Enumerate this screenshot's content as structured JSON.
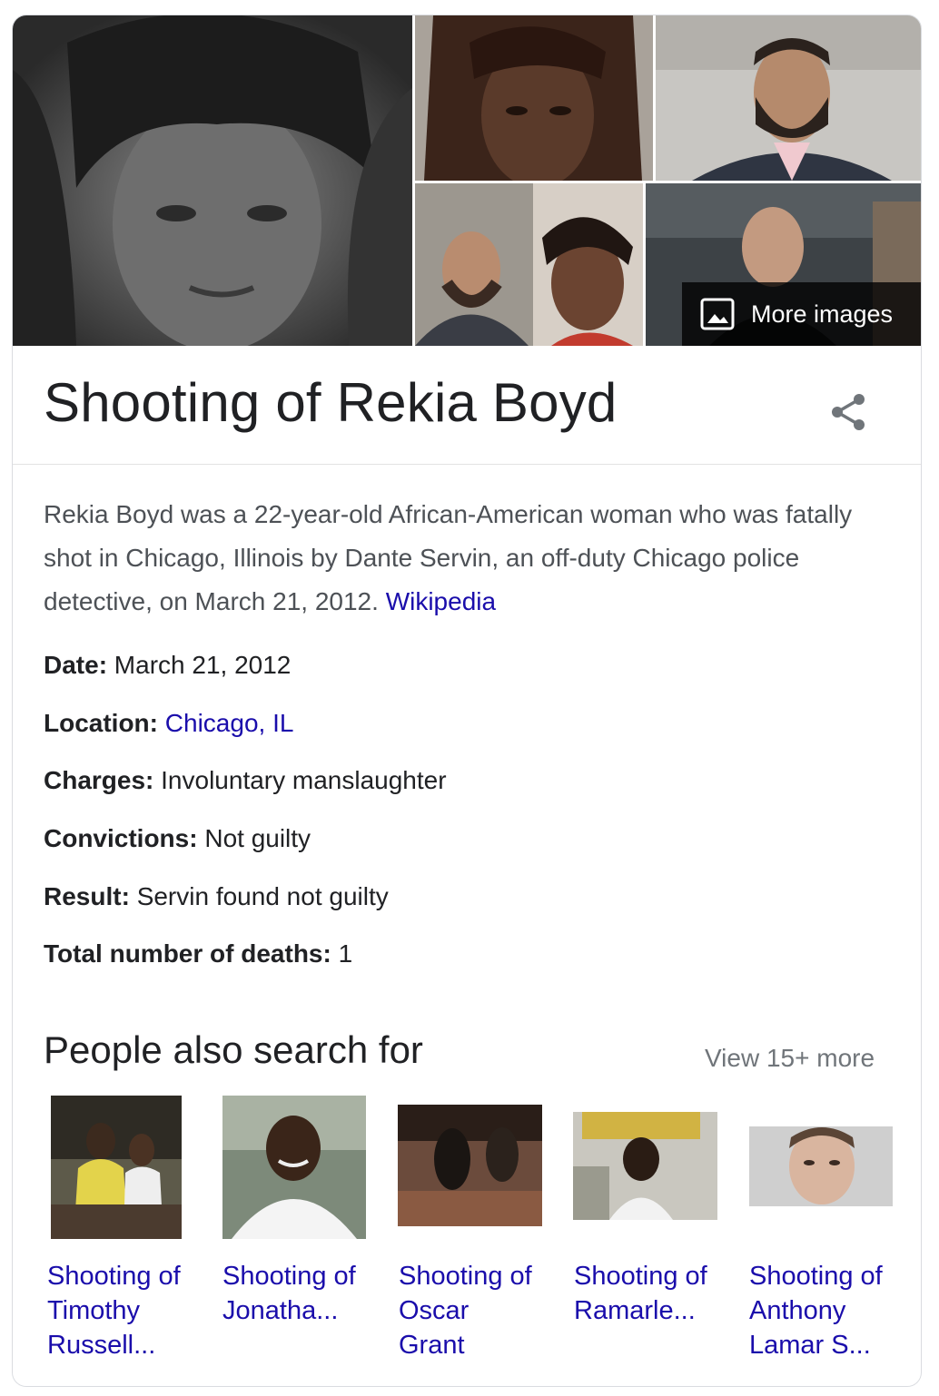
{
  "collage": {
    "more_images_label": "More images",
    "more_images_icon": "image-icon"
  },
  "title": "Shooting of Rekia Boyd",
  "share_icon": "share-icon",
  "description": {
    "text": "Rekia Boyd was a 22-year-old African-American woman who was fatally shot in Chicago, Illinois by Dante Servin, an off-duty Chicago police detective, on March 21, 2012.",
    "source_link": "Wikipedia"
  },
  "facts": [
    {
      "label": "Date:",
      "value": "March 21, 2012",
      "is_link": false
    },
    {
      "label": "Location:",
      "value": "Chicago, IL",
      "is_link": true
    },
    {
      "label": "Charges:",
      "value": "Involuntary manslaughter",
      "is_link": false
    },
    {
      "label": "Convictions:",
      "value": "Not guilty",
      "is_link": false
    },
    {
      "label": "Result:",
      "value": "Servin found not guilty",
      "is_link": false
    },
    {
      "label": "Total number of deaths:",
      "value": "1",
      "is_link": false
    }
  ],
  "people_also_search": {
    "heading": "People also search for",
    "view_more": "View 15+ more",
    "items": [
      {
        "line1": "Shooting of",
        "line2": "Timothy",
        "line3": "Russell..."
      },
      {
        "line1": "Shooting of",
        "line2": "Jonatha...",
        "line3": ""
      },
      {
        "line1": "Shooting of",
        "line2": "Oscar",
        "line3": "Grant"
      },
      {
        "line1": "Shooting of",
        "line2": "Ramarle...",
        "line3": ""
      },
      {
        "line1": "Shooting of",
        "line2": "Anthony",
        "line3": "Lamar S..."
      }
    ]
  },
  "colors": {
    "link": "#1a0dab",
    "text": "#202124",
    "secondary": "#4d5156",
    "muted": "#70757a",
    "border": "#dadce0"
  }
}
